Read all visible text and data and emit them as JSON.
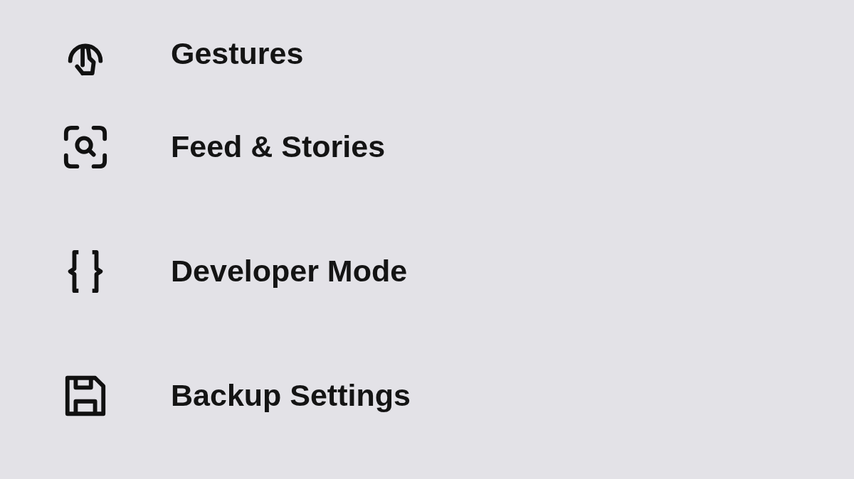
{
  "menu": {
    "items": [
      {
        "label": "Gestures",
        "kind": "touch"
      },
      {
        "label": "Feed & Stories",
        "kind": "scan"
      },
      {
        "label": "Developer Mode",
        "kind": "code"
      },
      {
        "label": "Backup Settings",
        "kind": "save"
      }
    ]
  }
}
